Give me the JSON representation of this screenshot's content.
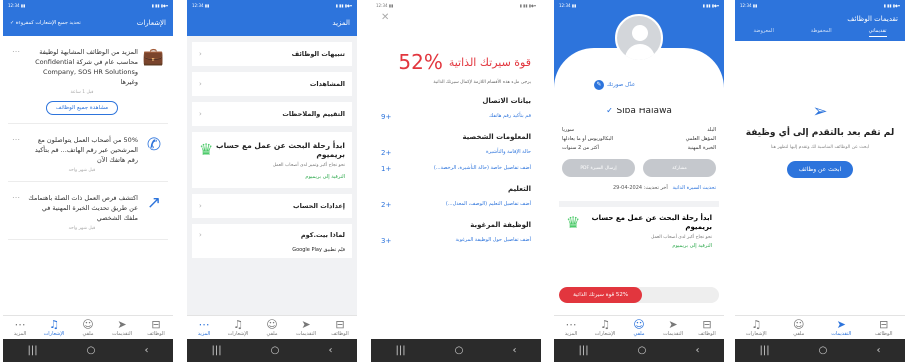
{
  "status": {
    "left": "▾◆▮ ▮▮ ▮",
    "right": "▮▮ 12:34"
  },
  "nav": [
    {
      "label": "الوظائف",
      "icon": "briefcase-icon"
    },
    {
      "label": "التقديمات",
      "icon": "send-icon"
    },
    {
      "label": "ملفي",
      "icon": "user-icon"
    },
    {
      "label": "الإشعارات",
      "icon": "bell-icon"
    },
    {
      "label": "المزيد",
      "icon": "more-icon"
    }
  ],
  "sys": {
    "back": "‹",
    "home": "○",
    "recent": "|||"
  },
  "s1": {
    "title": "الإشعارات",
    "mark_read": "تحديد جميع الإشعارات كمقروءة ✓",
    "cards": [
      {
        "text": "المزيد من الوظائف المشابهة لوظيفة محاسب عام في شركة Confidential وCompany, SOS HR Solutions وغيرها",
        "time": "قبل 1 ساعة",
        "button": "مشاهدة جميع الوظائف"
      },
      {
        "text": "50% من أصحاب العمل يتواصلون مع المرشحين عبر رقم الهاتف... قم بتأكيد رقم هاتفك الآن",
        "time": "قبل شهر واحد"
      },
      {
        "text": "اكتشف فرص العمل ذات الصلة باهتمامك عن طريق تحديث الخبرة المهنية في ملفك الشخصي",
        "time": "قبل شهر واحد"
      }
    ]
  },
  "s2": {
    "title": "المزيد",
    "rows": [
      "تنبيهات الوظائف",
      "المشاهدات",
      "التقييم والملاحظات"
    ],
    "premium": {
      "title": "ابدأ رحلة البحث عن عمل مع حساب بريميوم",
      "sub": "نحو نجاح أكبر وتميز لدى أصحاب العمل",
      "link": "الترقية إلى بريميوم"
    },
    "rows2": [
      "إعدادات الحساب",
      "لماذا بيت.كوم",
      "قيّم تطبيق Google Play"
    ]
  },
  "s3": {
    "percent": "52%",
    "title": "قوة سيرتك الذاتية",
    "sub": "يرجى ملء هذه الأقسام اللازمة لإكمال سيرتك الذاتية",
    "sections": [
      {
        "title": "بيانات الاتصال",
        "item": "قم بتأكيد رقم هاتفك",
        "points": "+9"
      },
      {
        "title": "المعلومات الشخصية",
        "item": "حالة الإقامة والتأشيرة",
        "points": "+2",
        "item2": "أضف تفاصيل خاصة (حالة التأشيرة، الرخصة...)",
        "points2": "+1"
      },
      {
        "title": "التعليم",
        "item": "أضف تفاصيل التعليم (الوصف، المعدل...)",
        "points": "+2"
      },
      {
        "title": "الوظيفة المرغوبة",
        "item": "أضف تفاصيل حول الوظيفة المرغوبة",
        "points": "+3"
      }
    ]
  },
  "s4": {
    "edit_photo": "عدّل صورتك",
    "name": "Siba Halawa",
    "info": [
      {
        "label": "البلد",
        "value": "سوريا"
      },
      {
        "label": "المؤهل العلمي",
        "value": "البكالوريوس أو ما يعادلها"
      },
      {
        "label": "الخبرة المهنية",
        "value": "أكثر من 2 سنوات"
      }
    ],
    "btn_cv": "إرسال السيرة PDF",
    "btn_share": "مشاركة",
    "updated": "آخر تحديث: 2024-04-29",
    "update_link": "تحديث السيرة الذاتية",
    "premium_title": "ابدأ رحلة البحث عن عمل مع حساب بريميوم",
    "premium_sub": "نحو نجاح أكبر لدى أصحاب العمل",
    "premium_link": "الترقية إلى بريميوم",
    "strength_label": "52% قوة سيرتك الذاتية",
    "strength_value": 0.52
  },
  "s5": {
    "title": "تقديمات الوظائف",
    "tabs": [
      "تقديماتي",
      "المحفوظة",
      "المعروضة"
    ],
    "empty_title": "لم تقم بعد بالتقدم إلى أي وظيفة",
    "empty_sub": "ابحث عن الوظائف المناسبة لك وتقدم إليها لتظهر هنا",
    "button": "ابحث عن وظائف"
  },
  "colors": {
    "primary": "#2d74dc",
    "danger": "#e2363e",
    "success": "#4ecb6b"
  }
}
